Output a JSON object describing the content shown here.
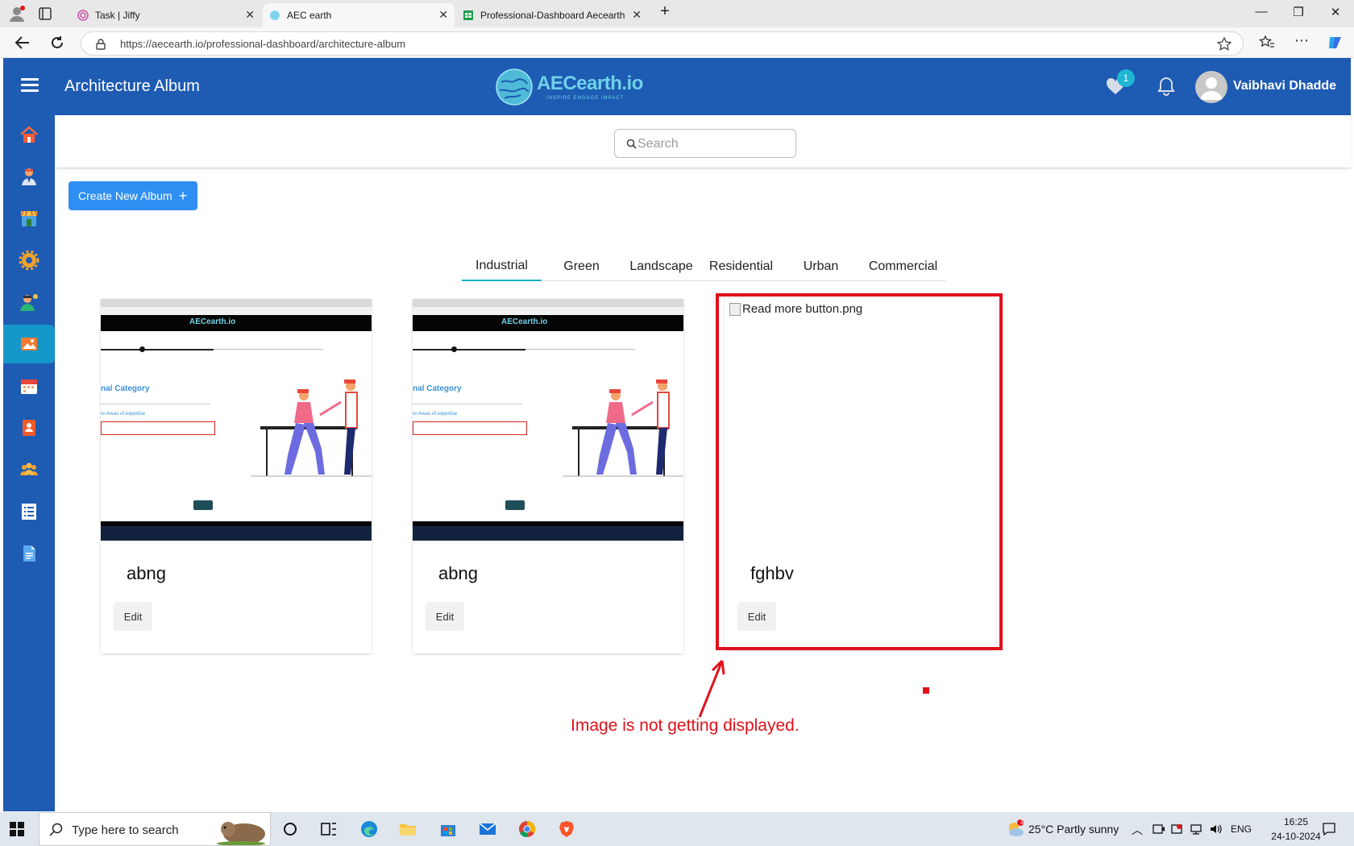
{
  "browser": {
    "tabs": [
      {
        "title": "Task | Jiffy"
      },
      {
        "title": "AEC earth"
      },
      {
        "title": "Professional-Dashboard Aecearth"
      }
    ],
    "url": "https://aecearth.io/professional-dashboard/architecture-album"
  },
  "header": {
    "title": "Architecture Album",
    "logo_text": "AECearth.io",
    "logo_tagline": "INSPIRE ENGAGE IMPACT",
    "favorites_count": "1",
    "user_name": "Vaibhavi Dhadde"
  },
  "sidebar": {
    "items": [
      {
        "icon": "home-icon"
      },
      {
        "icon": "professional-icon"
      },
      {
        "icon": "store-icon"
      },
      {
        "icon": "settings-gear-icon"
      },
      {
        "icon": "expert-icon"
      },
      {
        "icon": "album-icon",
        "active": true
      },
      {
        "icon": "calendar-icon"
      },
      {
        "icon": "contact-book-icon"
      },
      {
        "icon": "community-icon"
      },
      {
        "icon": "list-icon"
      },
      {
        "icon": "document-icon"
      }
    ]
  },
  "search": {
    "placeholder": "Search"
  },
  "create_button": {
    "label": "Create New Album",
    "icon": "+"
  },
  "categories": [
    "Industrial",
    "Green",
    "Landscape",
    "Residential",
    "Urban",
    "Commercial"
  ],
  "active_category": "Industrial",
  "albums": [
    {
      "title": "abng",
      "edit_label": "Edit",
      "image": "screenshot-thumbnail"
    },
    {
      "title": "abng",
      "edit_label": "Edit",
      "image": "screenshot-thumbnail"
    },
    {
      "title": "fghbv",
      "edit_label": "Edit",
      "image_alt": "Read more button.png",
      "image_broken": true
    }
  ],
  "thumbnail": {
    "logo": "AECearth.io",
    "category_text": "nal Category",
    "expertise_text": "or Areas of expertise",
    "link_text": "on"
  },
  "annotation": {
    "text": "Image is not getting displayed.",
    "color": "#e0111b"
  },
  "taskbar": {
    "search_text": "Type here to search",
    "weather": "25°C  Partly sunny",
    "weather_badge": "1",
    "language": "ENG",
    "time": "16:25",
    "date": "24-10-2024"
  },
  "colors": {
    "header": "#1e5bb3",
    "accent": "#2f8ff2",
    "active_tab_underline": "#1ab0ba"
  }
}
